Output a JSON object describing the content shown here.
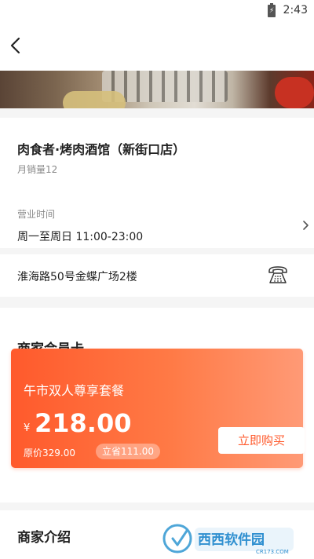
{
  "status_bar": {
    "time": "2:43",
    "battery_icon": "battery-charging-icon"
  },
  "nav": {
    "back_icon": "chevron-left-icon"
  },
  "shop": {
    "name": "肉食者·烤肉酒馆（新街口店）",
    "monthly_sales": "月销量12",
    "hours_label": "营业时间",
    "hours_value": "周一至周日 11:00-23:00",
    "address": "淮海路50号金蝶广场2楼",
    "phone_icon": "telephone-icon"
  },
  "member": {
    "section_title": "商家会员卡",
    "card": {
      "title": "午市双人尊享套餐",
      "currency": "¥",
      "price": "218.00",
      "original_price": "原价329.00",
      "save": "立省111.00",
      "buy_label": "立即购买"
    }
  },
  "intro": {
    "section_title": "商家介绍"
  },
  "watermark": {
    "text": "西西软件园",
    "sub": "CR173.COM"
  },
  "colors": {
    "accent": "#ff5a2c",
    "background": "#f5f5f5",
    "text": "#222222",
    "muted": "#888888"
  }
}
